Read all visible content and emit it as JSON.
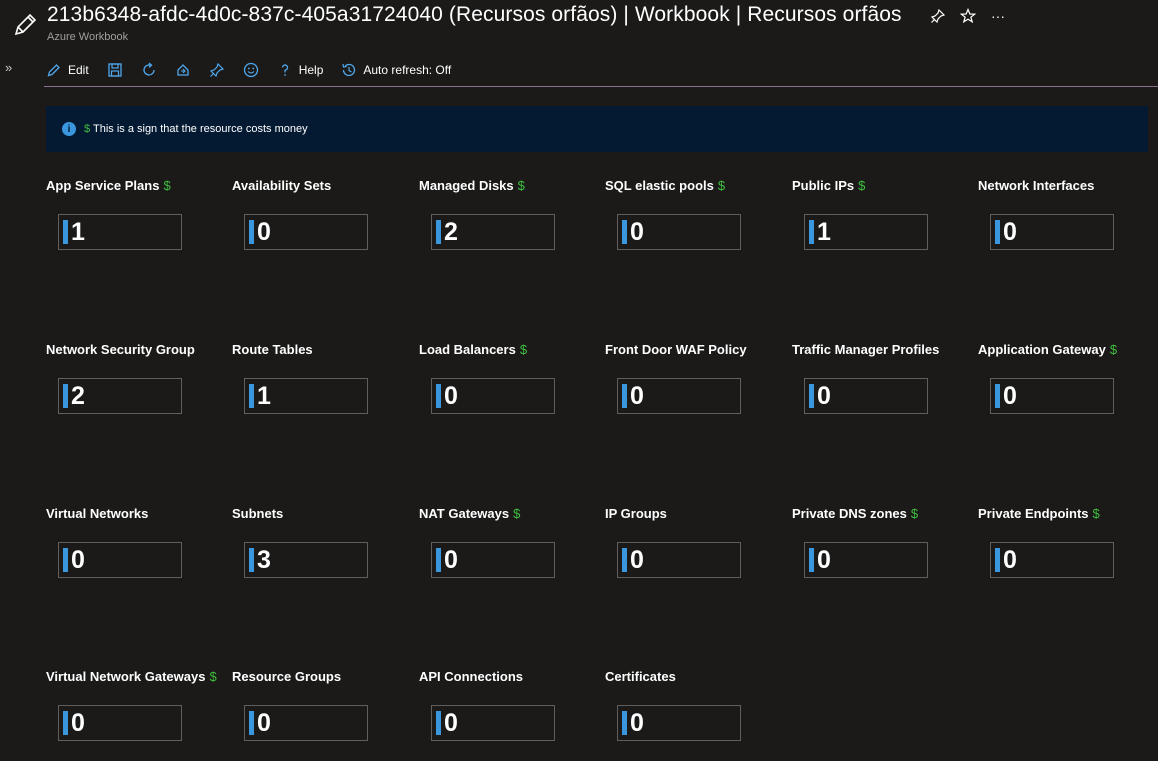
{
  "header": {
    "title": "213b6348-afdc-4d0c-837c-405a31724040 (Recursos orfãos) | Workbook | Recursos orfãos",
    "subtitle": "Azure Workbook",
    "icons": [
      "pencil-icon",
      "pin-icon",
      "star-icon",
      "more-icon"
    ],
    "more_glyph": "···"
  },
  "sidebar": {
    "expand_glyph": "»"
  },
  "toolbar": {
    "edit_label": "Edit",
    "help_label": "Help",
    "auto_refresh_label": "Auto refresh: Off",
    "icons": [
      "edit-icon",
      "save-icon",
      "refresh-icon",
      "share-icon",
      "pin-icon",
      "feedback-icon",
      "help-icon",
      "auto-refresh-icon"
    ]
  },
  "info": {
    "icon_glyph": "i",
    "dollar": "$",
    "text": "This is a sign that the resource costs money"
  },
  "tiles": [
    {
      "label": "App Service Plans",
      "cost": true,
      "value": "1"
    },
    {
      "label": "Availability Sets",
      "cost": false,
      "value": "0"
    },
    {
      "label": "Managed Disks",
      "cost": true,
      "value": "2"
    },
    {
      "label": "SQL elastic pools",
      "cost": true,
      "value": "0"
    },
    {
      "label": "Public IPs",
      "cost": true,
      "value": "1"
    },
    {
      "label": "Network Interfaces",
      "cost": false,
      "value": "0"
    },
    {
      "label": "Network Security Group",
      "cost": false,
      "value": "2"
    },
    {
      "label": "Route Tables",
      "cost": false,
      "value": "1"
    },
    {
      "label": "Load Balancers",
      "cost": true,
      "value": "0"
    },
    {
      "label": "Front Door WAF Policy",
      "cost": false,
      "value": "0"
    },
    {
      "label": "Traffic Manager Profiles",
      "cost": false,
      "value": "0"
    },
    {
      "label": "Application Gateway",
      "cost": true,
      "value": "0"
    },
    {
      "label": "Virtual Networks",
      "cost": false,
      "value": "0"
    },
    {
      "label": "Subnets",
      "cost": false,
      "value": "3"
    },
    {
      "label": "NAT Gateways",
      "cost": true,
      "value": "0"
    },
    {
      "label": "IP Groups",
      "cost": false,
      "value": "0"
    },
    {
      "label": "Private DNS zones",
      "cost": true,
      "value": "0"
    },
    {
      "label": "Private Endpoints",
      "cost": true,
      "value": "0"
    },
    {
      "label": "Virtual Network Gateways",
      "cost": true,
      "value": "0"
    },
    {
      "label": "Resource Groups",
      "cost": false,
      "value": "0"
    },
    {
      "label": "API Connections",
      "cost": false,
      "value": "0"
    },
    {
      "label": "Certificates",
      "cost": false,
      "value": "0"
    }
  ],
  "colors": {
    "background": "#1b1a19",
    "accent_blue": "#3a96dd",
    "cost_green": "#3fbf3f",
    "info_bar": "#041a33"
  }
}
